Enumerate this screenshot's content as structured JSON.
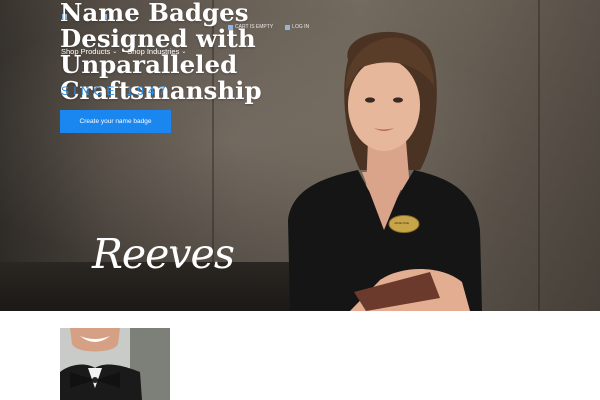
{
  "header": {
    "util_links": [
      "",
      ""
    ],
    "cart_label": "CART IS EMPTY",
    "login_label": "LOG IN",
    "nav": [
      {
        "label": "Shop Products"
      },
      {
        "label": "Shop Industries"
      }
    ]
  },
  "hero": {
    "title": "Name Badges Designed with Unparalleled Craftsmanship",
    "since": "SINCE 1947",
    "cta_label": "Create your name badge",
    "badge_text": "JANE DOE",
    "logo_text": "Reeves",
    "logo_mark": "®"
  },
  "colors": {
    "accent": "#1a87f0",
    "since_text": "#2d8fe6"
  },
  "icons": {
    "cart": "cart-icon",
    "login": "user-icon",
    "chevron": "chevron-down-icon"
  }
}
